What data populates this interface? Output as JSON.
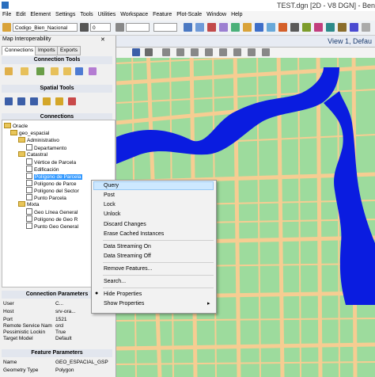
{
  "title_bar": {
    "title": "TEST.dgn [2D - V8 DGN] - Ben"
  },
  "menu": [
    "File",
    "Edit",
    "Element",
    "Settings",
    "Tools",
    "Utilities",
    "Workspace",
    "Feature",
    "Plot-Scale",
    "Window",
    "Help"
  ],
  "toolbar": {
    "feature_combo": "Codigo_Bien_Nacional",
    "level_combo": "0"
  },
  "left_panel": {
    "title": "Map Interoperability",
    "tabs": [
      "Connections",
      "Imports",
      "Exports"
    ],
    "connection_tools_label": "Connection Tools",
    "spatial_tools_label": "Spatial Tools",
    "connections_label": "Connections",
    "tree": [
      "Oracle",
      "geo_espacial",
      "Administrativo",
      "Departamento",
      "Catastral",
      "Vértice de Parcela",
      "Edificación",
      "Polígono de Parcela",
      "Polígono de Parce",
      "Polígono del Sector",
      "Punto Parcela",
      "Mixta",
      "Geo Línea General",
      "Polígono de Geo R",
      "Punto Geo General"
    ],
    "connection_parameters": {
      "label": "Connection Parameters",
      "rows": [
        {
          "key": "User",
          "value": "C..."
        },
        {
          "key": "Host",
          "value": "srv-ora..."
        },
        {
          "key": "Port",
          "value": "1521"
        },
        {
          "key": "Remote Service Nam",
          "value": "orcl"
        },
        {
          "key": "Pessimistic Lockin",
          "value": "True"
        },
        {
          "key": "Target Model",
          "value": "Default"
        }
      ]
    },
    "feature_parameters": {
      "label": "Feature Parameters",
      "rows": [
        {
          "key": "Name",
          "value": "GEO_ESPACIAL_GSP"
        },
        {
          "key": "Geometry Type",
          "value": "Polygon"
        }
      ]
    }
  },
  "view": {
    "title": "View 1, Defau"
  },
  "context_menu": {
    "items": [
      "Query",
      "Post",
      "Lock",
      "Unlock",
      "Discard Changes",
      "Erase Cached Instances",
      "Data Streaming On",
      "Data Streaming Off",
      "Remove Features...",
      "Search...",
      "Hide Properties",
      "Show Properties"
    ]
  },
  "colors": {
    "land": "#9ddb9d",
    "roads": "#f6cd92",
    "water": "#0a1ce0",
    "selection": "#3399ff"
  }
}
